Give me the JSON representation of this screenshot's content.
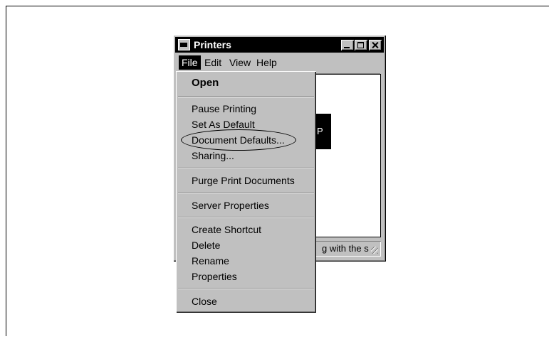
{
  "window": {
    "title": "Printers",
    "app_icon": "printer-folder-icon"
  },
  "menubar": {
    "items": [
      "File",
      "Edit",
      "View",
      "Help"
    ]
  },
  "client": {
    "printer_label_fragment": "P"
  },
  "statusbar": {
    "text": "g with the s"
  },
  "file_menu": {
    "items": [
      {
        "label": "Open"
      },
      {
        "label": "Pause Printing"
      },
      {
        "label": "Set As Default"
      },
      {
        "label": "Document Defaults..."
      },
      {
        "label": "Sharing..."
      },
      {
        "label": "Purge Print Documents"
      },
      {
        "label": "Server Properties"
      },
      {
        "label": "Create Shortcut"
      },
      {
        "label": "Delete"
      },
      {
        "label": "Rename"
      },
      {
        "label": "Properties"
      },
      {
        "label": "Close"
      }
    ]
  },
  "colors": {
    "face": "#c0c0c0",
    "title_bar": "#000000",
    "highlight": "#000000"
  }
}
